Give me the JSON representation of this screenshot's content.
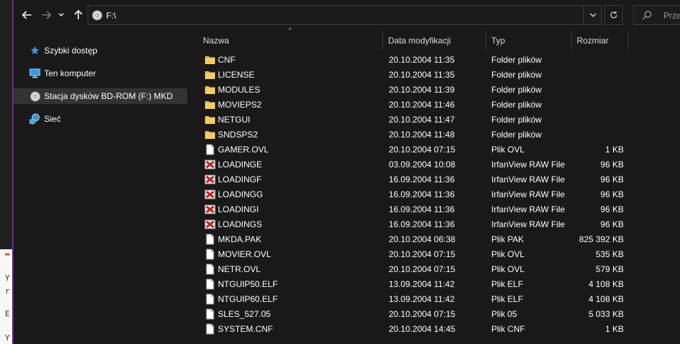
{
  "address": {
    "path": "F:\\",
    "search_placeholder": "Przes"
  },
  "nav": [
    {
      "label": "Szybki dostęp",
      "icon": "star-icon",
      "selected": false
    },
    {
      "label": "Ten komputer",
      "icon": "computer-icon",
      "selected": false
    },
    {
      "label": "Stacja dysków BD-ROM (F:) MKD",
      "icon": "disc-icon",
      "selected": true
    },
    {
      "label": "Sieć",
      "icon": "network-icon",
      "selected": false
    }
  ],
  "columns": {
    "name": "Nazwa",
    "date": "Data modyfikacji",
    "type": "Typ",
    "size": "Rozmiar"
  },
  "files": [
    {
      "name": "CNF",
      "date": "20.10.2004 11:35",
      "type": "Folder plików",
      "size": "",
      "icon": "folder-icon"
    },
    {
      "name": "LICENSE",
      "date": "20.10.2004 11:35",
      "type": "Folder plików",
      "size": "",
      "icon": "folder-icon"
    },
    {
      "name": "MODULES",
      "date": "20.10.2004 11:39",
      "type": "Folder plików",
      "size": "",
      "icon": "folder-icon"
    },
    {
      "name": "MOVIEPS2",
      "date": "20.10.2004 11:46",
      "type": "Folder plików",
      "size": "",
      "icon": "folder-icon"
    },
    {
      "name": "NETGUI",
      "date": "20.10.2004 11:47",
      "type": "Folder plików",
      "size": "",
      "icon": "folder-icon"
    },
    {
      "name": "SNDSPS2",
      "date": "20.10.2004 11:48",
      "type": "Folder plików",
      "size": "",
      "icon": "folder-icon"
    },
    {
      "name": "GAMER.OVL",
      "date": "20.10.2004 07:15",
      "type": "Plik OVL",
      "size": "1 KB",
      "icon": "file-icon"
    },
    {
      "name": "LOADINGE",
      "date": "03.09.2004 10:08",
      "type": "IrfanView RAW File",
      "size": "96 KB",
      "icon": "irfanview-icon"
    },
    {
      "name": "LOADINGF",
      "date": "16.09.2004 11:36",
      "type": "IrfanView RAW File",
      "size": "96 KB",
      "icon": "irfanview-icon"
    },
    {
      "name": "LOADINGG",
      "date": "16.09.2004 11:36",
      "type": "IrfanView RAW File",
      "size": "96 KB",
      "icon": "irfanview-icon"
    },
    {
      "name": "LOADINGI",
      "date": "16.09.2004 11:36",
      "type": "IrfanView RAW File",
      "size": "96 KB",
      "icon": "irfanview-icon"
    },
    {
      "name": "LOADINGS",
      "date": "16.09.2004 11:36",
      "type": "IrfanView RAW File",
      "size": "96 KB",
      "icon": "irfanview-icon"
    },
    {
      "name": "MKDA.PAK",
      "date": "20.10.2004 06:38",
      "type": "Plik PAK",
      "size": "825 392 KB",
      "icon": "file-icon"
    },
    {
      "name": "MOVIER.OVL",
      "date": "20.10.2004 07:15",
      "type": "Plik OVL",
      "size": "535 KB",
      "icon": "file-icon"
    },
    {
      "name": "NETR.OVL",
      "date": "20.10.2004 07:15",
      "type": "Plik OVL",
      "size": "579 KB",
      "icon": "file-icon"
    },
    {
      "name": "NTGUIP50.ELF",
      "date": "13.09.2004 11:42",
      "type": "Plik ELF",
      "size": "4 108 KB",
      "icon": "file-icon"
    },
    {
      "name": "NTGUIP60.ELF",
      "date": "13.09.2004 11:42",
      "type": "Plik ELF",
      "size": "4 108 KB",
      "icon": "file-icon"
    },
    {
      "name": "SLES_527.05",
      "date": "20.10.2004 07:15",
      "type": "Plik 05",
      "size": "5 033 KB",
      "icon": "file-icon"
    },
    {
      "name": "SYSTEM.CNF",
      "date": "20.10.2004 14:45",
      "type": "Plik CNF",
      "size": "1 KB",
      "icon": "file-icon"
    }
  ],
  "background_window_text": [
    "Y",
    "r",
    "E",
    "Y"
  ]
}
